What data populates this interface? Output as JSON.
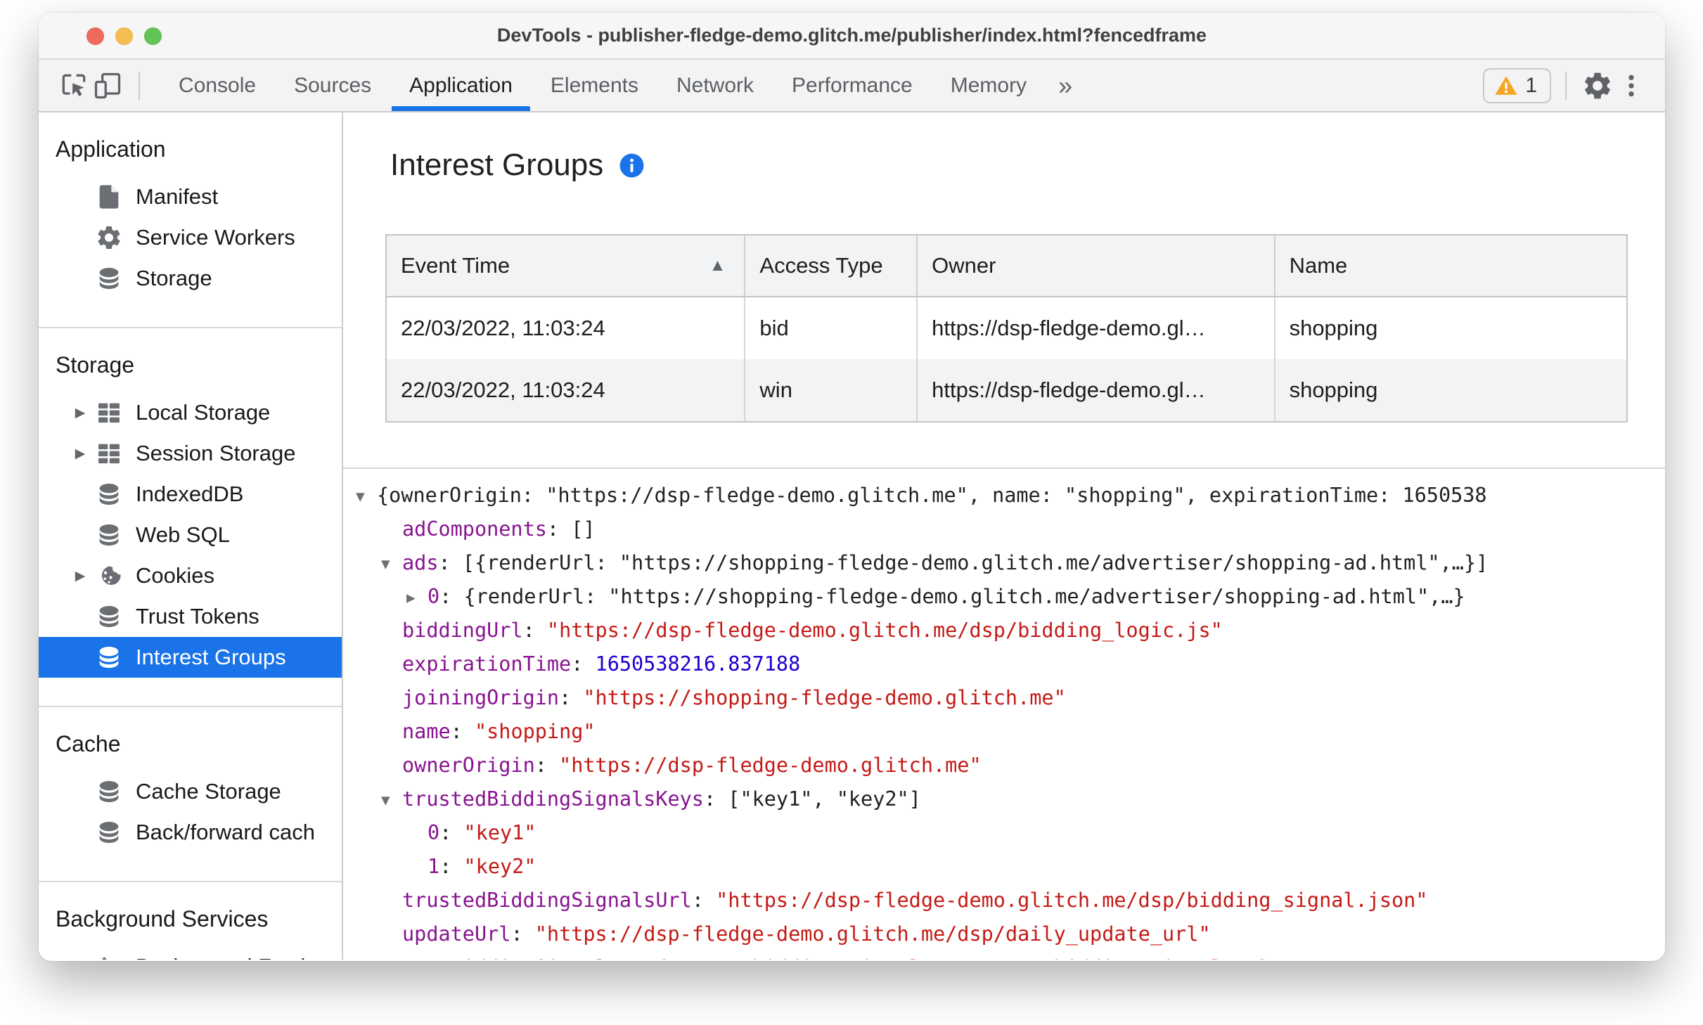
{
  "window_title": "DevTools - publisher-fledge-demo.glitch.me/publisher/index.html?fencedframe",
  "colors": {
    "accent_blue": "#1a73e8",
    "selected_item_bg": "#1a73e8",
    "tree_key_purple": "#881391",
    "tree_string_red": "#c41a16",
    "tree_number_blue": "#1c00cf",
    "warning_yellow": "#f5a623",
    "toolbar_bg": "#f3f3f3"
  },
  "toolbar": {
    "left_icons": [
      "inspect-icon",
      "device-toolbar-icon"
    ],
    "tabs": [
      {
        "label": "Console"
      },
      {
        "label": "Sources"
      },
      {
        "label": "Application",
        "active": true
      },
      {
        "label": "Elements"
      },
      {
        "label": "Network"
      },
      {
        "label": "Performance"
      },
      {
        "label": "Memory"
      }
    ],
    "more_tabs": "»",
    "warning_count": "1"
  },
  "sidebar": {
    "sections": [
      {
        "title": "Application",
        "items": [
          {
            "label": "Manifest",
            "icon": "document"
          },
          {
            "label": "Service Workers",
            "icon": "gear"
          },
          {
            "label": "Storage",
            "icon": "database"
          }
        ]
      },
      {
        "title": "Storage",
        "items": [
          {
            "label": "Local Storage",
            "icon": "table",
            "expandable": true
          },
          {
            "label": "Session Storage",
            "icon": "table",
            "expandable": true
          },
          {
            "label": "IndexedDB",
            "icon": "database"
          },
          {
            "label": "Web SQL",
            "icon": "database"
          },
          {
            "label": "Cookies",
            "icon": "cookie",
            "expandable": true
          },
          {
            "label": "Trust Tokens",
            "icon": "database"
          },
          {
            "label": "Interest Groups",
            "icon": "database",
            "selected": true
          }
        ]
      },
      {
        "title": "Cache",
        "items": [
          {
            "label": "Cache Storage",
            "icon": "database"
          },
          {
            "label": "Back/forward cach",
            "icon": "database"
          }
        ]
      },
      {
        "title": "Background Services",
        "items": [
          {
            "label": "Background Fetch",
            "icon": "upload"
          }
        ]
      }
    ]
  },
  "main": {
    "heading": "Interest Groups",
    "table": {
      "columns": [
        "Event Time",
        "Access Type",
        "Owner",
        "Name"
      ],
      "sorted_column": "Event Time",
      "sort_direction": "asc",
      "sort_glyph": "▲",
      "rows": [
        [
          "22/03/2022, 11:03:24",
          "bid",
          "https://dsp-fledge-demo.gl…",
          "shopping"
        ],
        [
          "22/03/2022, 11:03:24",
          "win",
          "https://dsp-fledge-demo.gl…",
          "shopping"
        ]
      ]
    },
    "tree": {
      "lines": [
        {
          "indent": 0,
          "expander": "open",
          "key": null,
          "segments": [
            {
              "text": "{ownerOrigin: \"https://dsp-fledge-demo.glitch.me\", name: \"shopping\", expirationTime: 1650538",
              "type": "preview"
            }
          ]
        },
        {
          "indent": 1,
          "expander": null,
          "key": "adComponents",
          "segments": [
            {
              "text": "[]",
              "type": "preview"
            }
          ]
        },
        {
          "indent": 1,
          "expander": "open",
          "key": "ads",
          "segments": [
            {
              "text": "[{renderUrl: \"https://shopping-fledge-demo.glitch.me/advertiser/shopping-ad.html\",…}]",
              "type": "preview"
            }
          ]
        },
        {
          "indent": 2,
          "expander": "closed",
          "key": "0",
          "segments": [
            {
              "text": "{renderUrl: \"https://shopping-fledge-demo.glitch.me/advertiser/shopping-ad.html\",…}",
              "type": "preview"
            }
          ]
        },
        {
          "indent": 1,
          "expander": null,
          "key": "biddingUrl",
          "segments": [
            {
              "text": "\"https://dsp-fledge-demo.glitch.me/dsp/bidding_logic.js\"",
              "type": "string"
            }
          ]
        },
        {
          "indent": 1,
          "expander": null,
          "key": "expirationTime",
          "segments": [
            {
              "text": "1650538216.837188",
              "type": "number"
            }
          ]
        },
        {
          "indent": 1,
          "expander": null,
          "key": "joiningOrigin",
          "segments": [
            {
              "text": "\"https://shopping-fledge-demo.glitch.me\"",
              "type": "string"
            }
          ]
        },
        {
          "indent": 1,
          "expander": null,
          "key": "name",
          "segments": [
            {
              "text": "\"shopping\"",
              "type": "string"
            }
          ]
        },
        {
          "indent": 1,
          "expander": null,
          "key": "ownerOrigin",
          "segments": [
            {
              "text": "\"https://dsp-fledge-demo.glitch.me\"",
              "type": "string"
            }
          ]
        },
        {
          "indent": 1,
          "expander": "open",
          "key": "trustedBiddingSignalsKeys",
          "segments": [
            {
              "text": "[\"key1\", \"key2\"]",
              "type": "preview"
            }
          ]
        },
        {
          "indent": 2,
          "expander": null,
          "key": "0",
          "segments": [
            {
              "text": "\"key1\"",
              "type": "string"
            }
          ]
        },
        {
          "indent": 2,
          "expander": null,
          "key": "1",
          "segments": [
            {
              "text": "\"key2\"",
              "type": "string"
            }
          ]
        },
        {
          "indent": 1,
          "expander": null,
          "key": "trustedBiddingSignalsUrl",
          "segments": [
            {
              "text": "\"https://dsp-fledge-demo.glitch.me/dsp/bidding_signal.json\"",
              "type": "string"
            }
          ]
        },
        {
          "indent": 1,
          "expander": null,
          "key": "updateUrl",
          "segments": [
            {
              "text": "\"https://dsp-fledge-demo.glitch.me/dsp/daily_update_url\"",
              "type": "string"
            }
          ]
        },
        {
          "indent": 1,
          "expander": null,
          "key": "userBiddingSignals",
          "segments": [
            {
              "text": "\"{\\\"user_bidding_signals\\\":\\\"user_bidding_signals\\\"}\"",
              "type": "string"
            }
          ]
        }
      ]
    }
  }
}
